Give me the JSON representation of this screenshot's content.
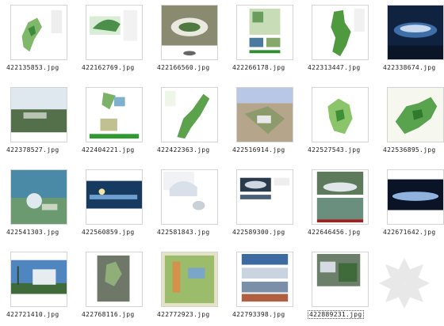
{
  "files": [
    {
      "name": "422135853.jpg",
      "icon": "plan-map-thumbnail"
    },
    {
      "name": "422162769.jpg",
      "icon": "plan-map-thumbnail"
    },
    {
      "name": "422166560.jpg",
      "icon": "stadium-photo-thumbnail"
    },
    {
      "name": "422266178.jpg",
      "icon": "document-page-thumbnail"
    },
    {
      "name": "422313447.jpg",
      "icon": "plan-map-thumbnail"
    },
    {
      "name": "422338674.jpg",
      "icon": "night-render-thumbnail"
    },
    {
      "name": "422378527.jpg",
      "icon": "aerial-photo-thumbnail"
    },
    {
      "name": "422404221.jpg",
      "icon": "document-page-thumbnail"
    },
    {
      "name": "422422363.jpg",
      "icon": "plan-map-thumbnail"
    },
    {
      "name": "422516914.jpg",
      "icon": "render-thumbnail"
    },
    {
      "name": "422527543.jpg",
      "icon": "plan-map-thumbnail"
    },
    {
      "name": "422536895.jpg",
      "icon": "plan-map-thumbnail"
    },
    {
      "name": "422541303.jpg",
      "icon": "aerial-render-thumbnail"
    },
    {
      "name": "422560859.jpg",
      "icon": "night-render-thumbnail"
    },
    {
      "name": "422581843.jpg",
      "icon": "render-thumbnail"
    },
    {
      "name": "422589300.jpg",
      "icon": "document-page-thumbnail"
    },
    {
      "name": "422646456.jpg",
      "icon": "render-thumbnail"
    },
    {
      "name": "422671642.jpg",
      "icon": "night-render-thumbnail"
    },
    {
      "name": "422721410.jpg",
      "icon": "render-thumbnail"
    },
    {
      "name": "422768116.jpg",
      "icon": "plan-map-thumbnail"
    },
    {
      "name": "422772923.jpg",
      "icon": "plan-map-thumbnail"
    },
    {
      "name": "422793398.jpg",
      "icon": "document-page-thumbnail"
    },
    {
      "name": "422889231.jpg",
      "icon": "document-page-thumbnail",
      "selected": true
    }
  ],
  "watermark": {
    "icon": "snowflake-watermark-logo",
    "color": "#e6e6e6"
  }
}
